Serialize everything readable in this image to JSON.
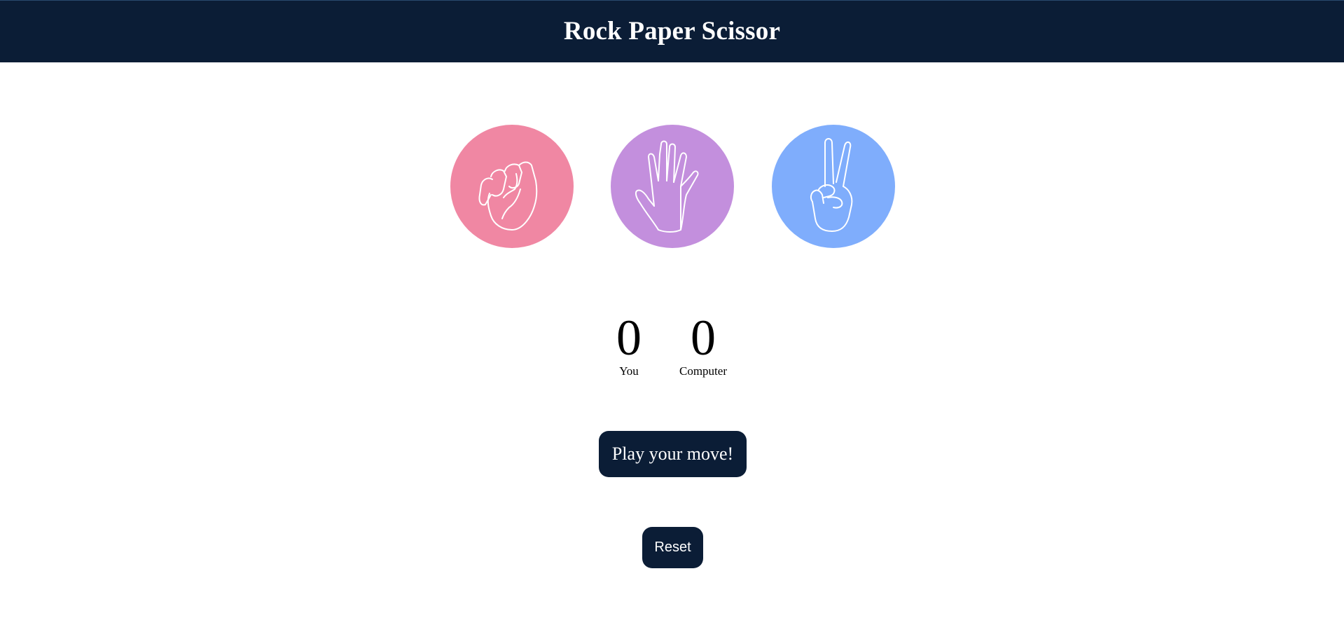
{
  "header": {
    "title": "Rock Paper Scissor"
  },
  "choices": [
    {
      "id": "rock",
      "icon": "rock-fist-icon",
      "color": "#f087a3"
    },
    {
      "id": "paper",
      "icon": "paper-hand-icon",
      "color": "#c38fdd"
    },
    {
      "id": "scissors",
      "icon": "scissors-hand-icon",
      "color": "#7fadfc"
    }
  ],
  "score": {
    "user": {
      "value": "0",
      "label": "You"
    },
    "computer": {
      "value": "0",
      "label": "Computer"
    }
  },
  "message": "Play your move!",
  "reset_label": "Reset",
  "colors": {
    "navbar": "#0b1d36",
    "button": "#0b1d36",
    "text_on_dark": "#ffffff"
  }
}
